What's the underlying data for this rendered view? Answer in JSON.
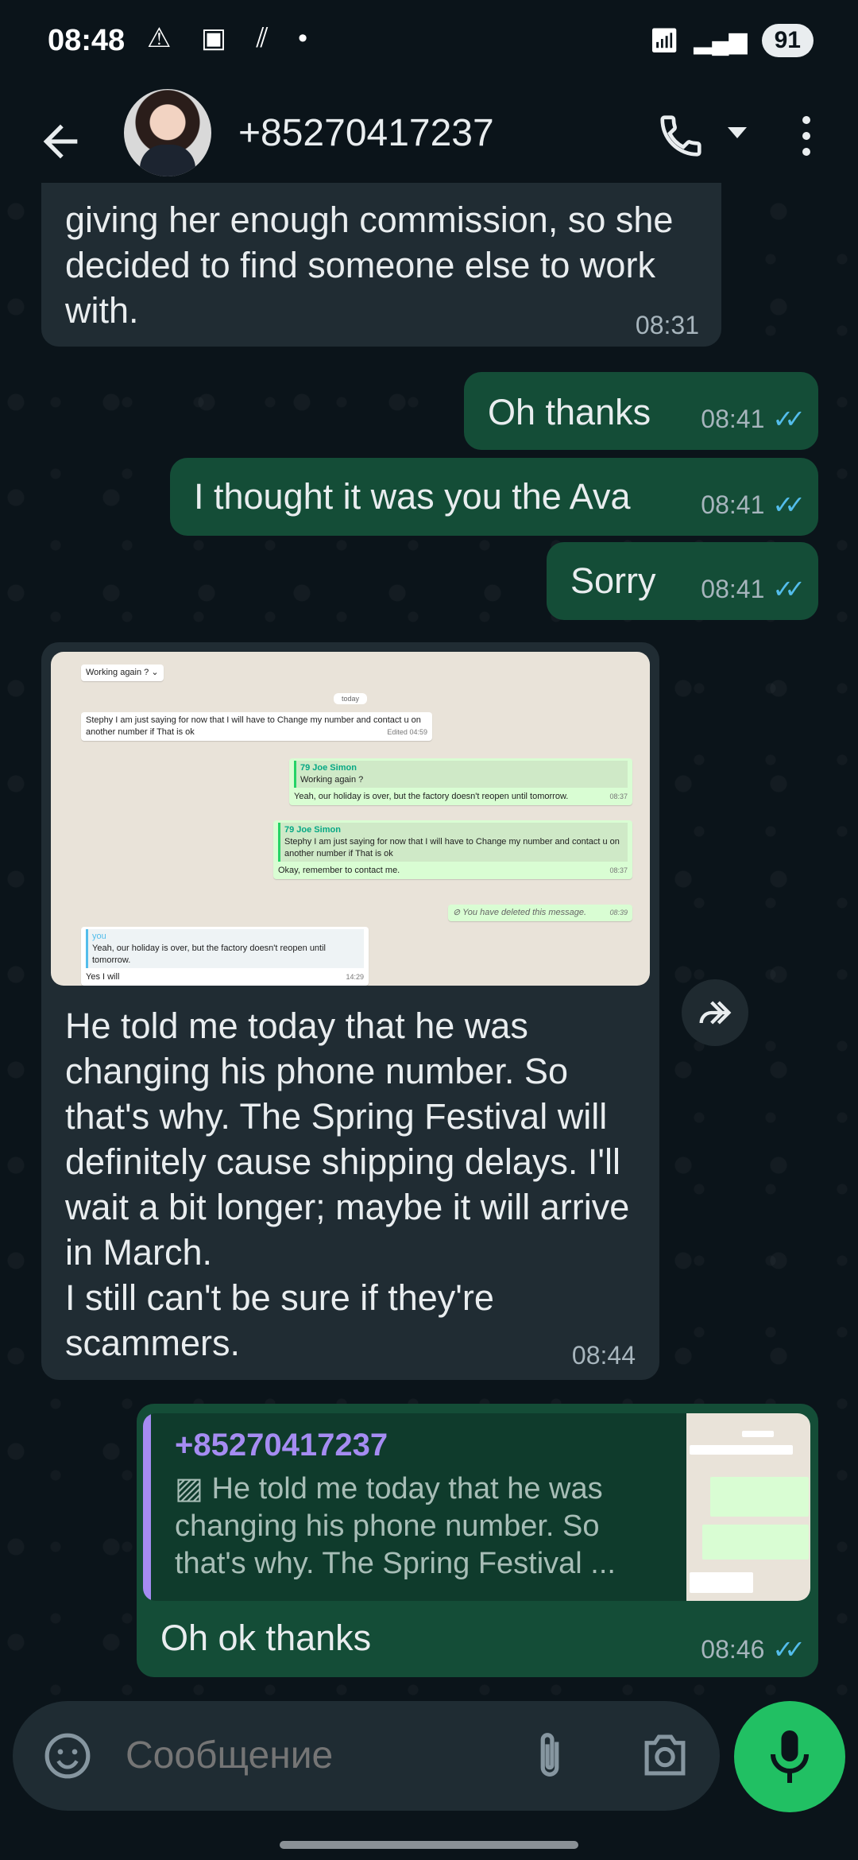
{
  "status_bar": {
    "time": "08:48",
    "battery": "91"
  },
  "header": {
    "contact": "+85270417237"
  },
  "messages": [
    {
      "text": "giving her enough commission, so she decided to find someone else to work with.",
      "time": "08:31"
    },
    {
      "text": "Oh thanks",
      "time": "08:41"
    },
    {
      "text": "I thought it was you the Ava",
      "time": "08:41"
    },
    {
      "text": "Sorry",
      "time": "08:41"
    },
    {
      "text": "He told me today that he was changing his phone number. So that's why. The Spring Festival will definitely cause shipping delays. I'll wait a bit longer; maybe it will arrive in March.\nI still can't be sure if they're scammers.",
      "time": "08:44"
    },
    {
      "text": "Oh ok thanks",
      "time": "08:46"
    }
  ],
  "screenshot": {
    "working_again_1": "Working again ?",
    "today": "today",
    "stephy_msg": "Stephy I am just saying for now that I will have to Change my number and contact u on another number if That is ok",
    "edited": "Edited",
    "edited_time": "04:59",
    "joe_name_1": "79 Joe Simon",
    "working_again_2": "Working again ?",
    "holiday_1": "Yeah, our holiday is over, but the factory doesn't reopen until tomorrow.",
    "time_1": "08:37",
    "joe_name_2": "79 Joe Simon",
    "stephy_quote": "Stephy I am just saying for now that I will have to Change my number and contact u on another number if That is ok",
    "okay_msg": "Okay, remember to contact me.",
    "time_2": "08:37",
    "deleted": "You have deleted this message.",
    "time_3": "08:39",
    "you": "you",
    "holiday_2": "Yeah, our holiday is over, but the factory doesn't reopen until tomorrow.",
    "yes_i_will": "Yes I will",
    "time_4": "14:29"
  },
  "reply_preview": {
    "name": "+85270417237",
    "text": "He told me today that he was changing his phone number. So that's why. The Spring Festival ..."
  },
  "composer": {
    "placeholder": "Сообщение"
  }
}
